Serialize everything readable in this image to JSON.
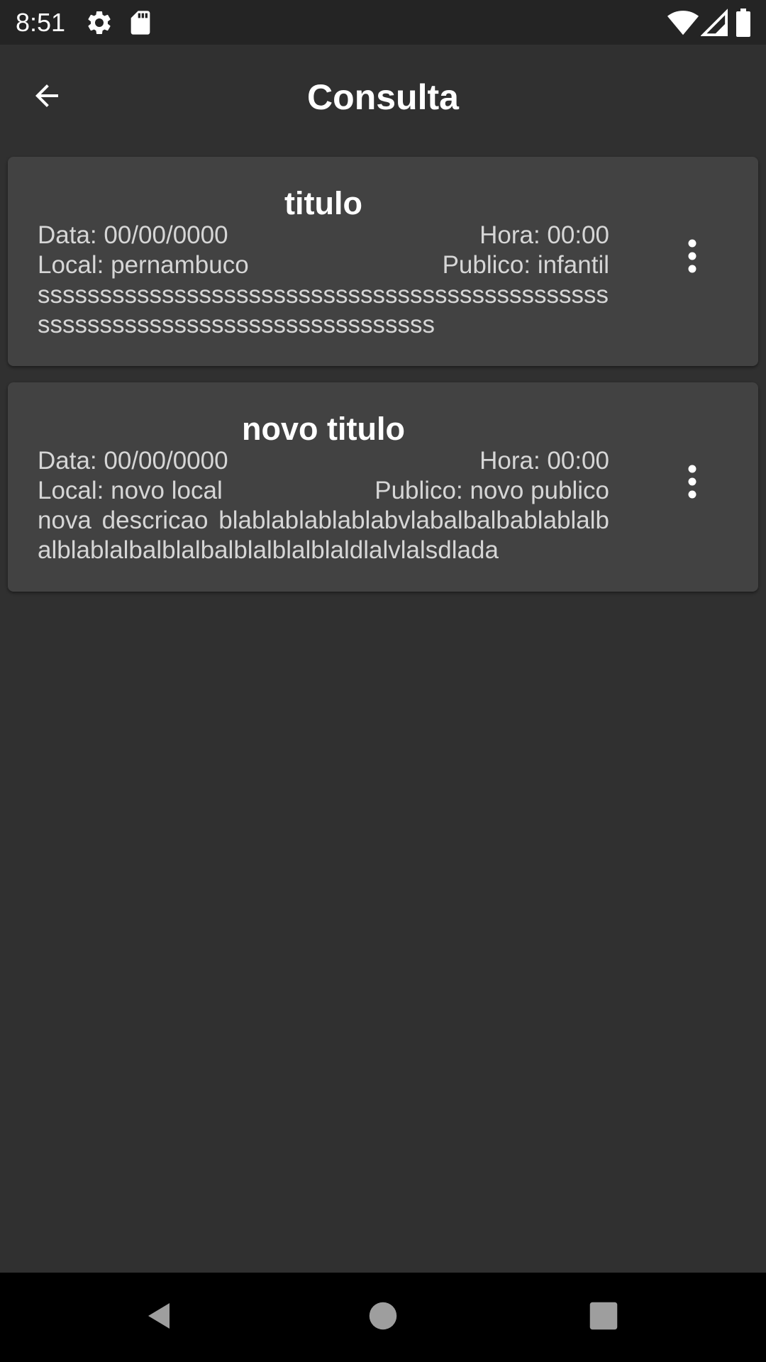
{
  "status_bar": {
    "time": "8:51",
    "icons": [
      "gear-icon",
      "sd-card-icon",
      "wifi-icon",
      "signal-icon",
      "battery-icon"
    ]
  },
  "app_bar": {
    "title": "Consulta",
    "back_icon": "arrow-back-icon"
  },
  "cards": [
    {
      "title": "titulo",
      "date": "Data: 00/00/0000",
      "time": "Hora: 00:00",
      "place": "Local: pernambuco",
      "audience": "Publico: infantil",
      "description": "ssssssssssssssssssssssssssssssssssssssssssssssssssssssssssssssssssssssssssssss"
    },
    {
      "title": "novo titulo",
      "date": "Data: 00/00/0000",
      "time": "Hora: 00:00",
      "place": "Local: novo local",
      "audience": "Publico: novo publico",
      "description": "nova  descricao  blablablablablabvlabalbalbablablalbalblablalbalblalbalblalblalblaldlalvlalsdlada"
    }
  ],
  "nav_bar": {
    "back_icon": "triangle-back-icon",
    "home_icon": "circle-home-icon",
    "recents_icon": "square-recents-icon"
  },
  "colors": {
    "background": "#303030",
    "card": "#424242",
    "text_primary": "#ffffff",
    "text_secondary": "#d6d6d6"
  }
}
